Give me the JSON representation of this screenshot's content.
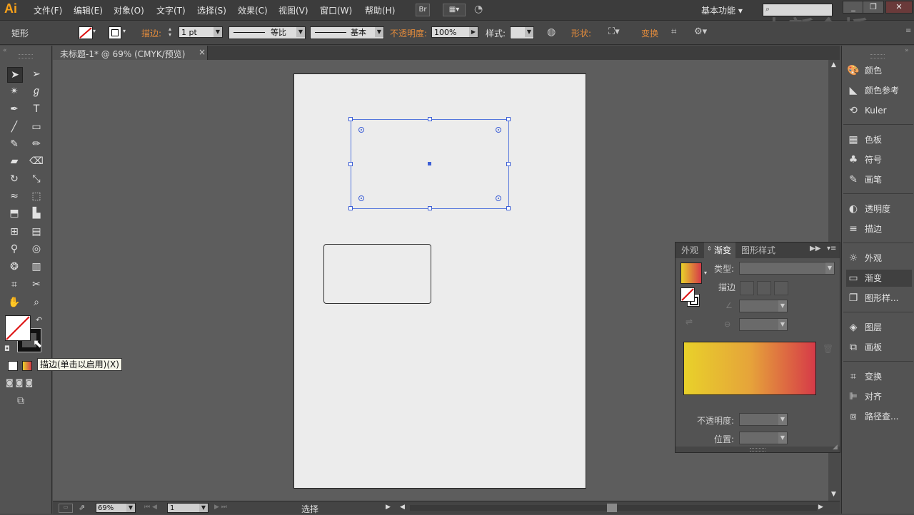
{
  "app": {
    "logo": "Ai"
  },
  "menu": {
    "items": [
      "文件(F)",
      "编辑(E)",
      "对象(O)",
      "文字(T)",
      "选择(S)",
      "效果(C)",
      "视图(V)",
      "窗口(W)",
      "帮助(H)"
    ],
    "bridge_button": "Br",
    "workspace": "基本功能",
    "watermark": "中新金桥"
  },
  "control_bar": {
    "tool_name": "矩形",
    "stroke_label": "描边",
    "stroke_weight": "1 pt",
    "profile_label": "等比",
    "brush_label": "基本",
    "opacity_label": "不透明度",
    "opacity_value": "100%",
    "style_label": "样式",
    "shape_label": "形状",
    "transform_label": "变换"
  },
  "document": {
    "tab_title": "未标题-1* @ 69% (CMYK/预览)",
    "close_glyph": "×"
  },
  "tooltip": "描边(单击以启用)(X)",
  "status_bar": {
    "zoom": "69%",
    "page": "1",
    "status_text": "选择"
  },
  "right_dock": {
    "groups": [
      [
        {
          "icon": "palette-icon",
          "glyph": "🎨",
          "label": "颜色"
        },
        {
          "icon": "color-guide-icon",
          "glyph": "◣",
          "label": "颜色参考"
        },
        {
          "icon": "kuler-icon",
          "glyph": "⟲",
          "label": "Kuler"
        }
      ],
      [
        {
          "icon": "swatches-icon",
          "glyph": "▦",
          "label": "色板"
        },
        {
          "icon": "symbols-icon",
          "glyph": "♣",
          "label": "符号"
        },
        {
          "icon": "brushes-icon",
          "glyph": "✎",
          "label": "画笔"
        }
      ],
      [
        {
          "icon": "transparency-icon",
          "glyph": "◐",
          "label": "透明度"
        },
        {
          "icon": "stroke-icon",
          "glyph": "≡",
          "label": "描边"
        }
      ],
      [
        {
          "icon": "appearance-icon",
          "glyph": "☼",
          "label": "外观"
        },
        {
          "icon": "gradient-icon",
          "glyph": "▭",
          "label": "渐变"
        },
        {
          "icon": "graphic-styles-icon",
          "glyph": "❐",
          "label": "图形样..."
        }
      ],
      [
        {
          "icon": "layers-icon",
          "glyph": "◈",
          "label": "图层"
        },
        {
          "icon": "artboards-icon",
          "glyph": "⧉",
          "label": "画板"
        }
      ],
      [
        {
          "icon": "transform-icon",
          "glyph": "⌗",
          "label": "变换"
        },
        {
          "icon": "align-icon",
          "glyph": "⊫",
          "label": "对齐"
        },
        {
          "icon": "pathfinder-icon",
          "glyph": "⧈",
          "label": "路径查..."
        }
      ]
    ]
  },
  "gradient_panel": {
    "tabs": [
      "外观",
      "渐变",
      "图形样式"
    ],
    "type_label": "类型:",
    "stroke_label": "描边",
    "opacity_label": "不透明度:",
    "position_label": "位置:",
    "colors": {
      "start": "#e8d12a",
      "mid": "#e6a43a",
      "end": "#d63a48"
    }
  }
}
